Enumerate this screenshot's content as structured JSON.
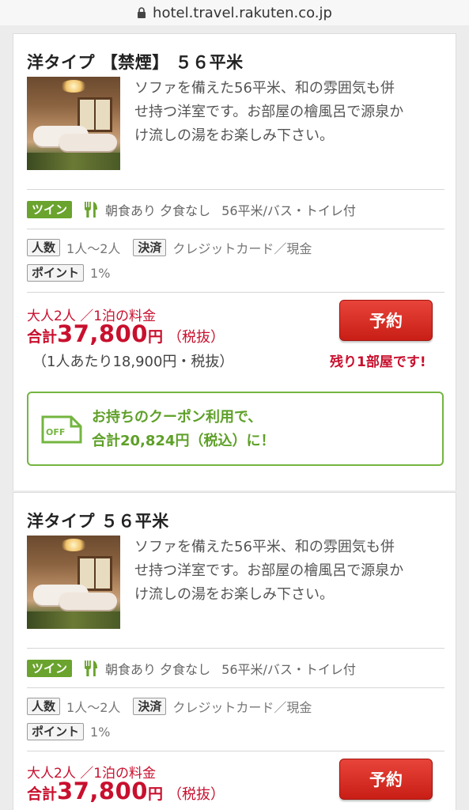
{
  "browser": {
    "url": "hotel.travel.rakuten.co.jp"
  },
  "rooms": [
    {
      "title": "洋タイプ 【禁煙】 ５６平米",
      "description_lines": [
        "ソファを備えた56平米、和の雰囲気も併",
        "せ持つ洋室です。お部屋の檜風呂で源泉か",
        "け流しの湯をお楽しみ下さい。"
      ],
      "room_type_badge": "ツイン",
      "meal_breakfast": "朝食あり",
      "meal_dinner": "夕食なし",
      "room_spec": "56平米/バス・トイレ付",
      "capacity_label": "人数",
      "capacity_value": "1人〜2人",
      "payment_label": "決済",
      "payment_value": "クレジットカード／現金",
      "points_label": "ポイント",
      "points_value": "1%",
      "price_condition": "大人2人 ／1泊の料金",
      "total_prefix": "合計",
      "total_amount": "37,800",
      "total_unit": "円",
      "tax_note": "（税抜）",
      "per_person": "（1人あたり18,900円・税抜）",
      "reserve_label": "予約",
      "remaining_text": "残り1部屋です!",
      "coupon": {
        "line1": "お持ちのクーポン利用で、",
        "line2": "合計20,824円（税込）に！"
      }
    },
    {
      "title": "洋タイプ ５６平米",
      "description_lines": [
        "ソファを備えた56平米、和の雰囲気も併",
        "せ持つ洋室です。お部屋の檜風呂で源泉か",
        "け流しの湯をお楽しみ下さい。"
      ],
      "room_type_badge": "ツイン",
      "meal_breakfast": "朝食あり",
      "meal_dinner": "夕食なし",
      "room_spec": "56平米/バス・トイレ付",
      "capacity_label": "人数",
      "capacity_value": "1人〜2人",
      "payment_label": "決済",
      "payment_value": "クレジットカード／現金",
      "points_label": "ポイント",
      "points_value": "1%",
      "price_condition": "大人2人 ／1泊の料金",
      "total_prefix": "合計",
      "total_amount": "37,800",
      "total_unit": "円",
      "tax_note": "（税抜）",
      "reserve_label": "予約"
    }
  ],
  "icons": {
    "lock": "lock-icon",
    "meal": "fork-knife-icon",
    "coupon": "off-ticket-icon"
  },
  "colors": {
    "accent_red": "#c8102e",
    "button_red": "#d62a20",
    "badge_green": "#6aa32d",
    "coupon_green": "#74b540"
  }
}
